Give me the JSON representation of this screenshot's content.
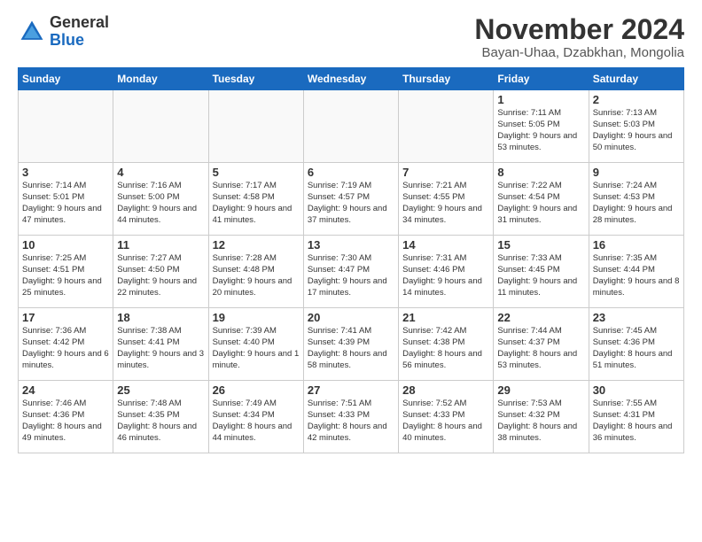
{
  "logo": {
    "general": "General",
    "blue": "Blue"
  },
  "header": {
    "month": "November 2024",
    "location": "Bayan-Uhaa, Dzabkhan, Mongolia"
  },
  "weekdays": [
    "Sunday",
    "Monday",
    "Tuesday",
    "Wednesday",
    "Thursday",
    "Friday",
    "Saturday"
  ],
  "weeks": [
    [
      {
        "day": "",
        "info": ""
      },
      {
        "day": "",
        "info": ""
      },
      {
        "day": "",
        "info": ""
      },
      {
        "day": "",
        "info": ""
      },
      {
        "day": "",
        "info": ""
      },
      {
        "day": "1",
        "info": "Sunrise: 7:11 AM\nSunset: 5:05 PM\nDaylight: 9 hours and 53 minutes."
      },
      {
        "day": "2",
        "info": "Sunrise: 7:13 AM\nSunset: 5:03 PM\nDaylight: 9 hours and 50 minutes."
      }
    ],
    [
      {
        "day": "3",
        "info": "Sunrise: 7:14 AM\nSunset: 5:01 PM\nDaylight: 9 hours and 47 minutes."
      },
      {
        "day": "4",
        "info": "Sunrise: 7:16 AM\nSunset: 5:00 PM\nDaylight: 9 hours and 44 minutes."
      },
      {
        "day": "5",
        "info": "Sunrise: 7:17 AM\nSunset: 4:58 PM\nDaylight: 9 hours and 41 minutes."
      },
      {
        "day": "6",
        "info": "Sunrise: 7:19 AM\nSunset: 4:57 PM\nDaylight: 9 hours and 37 minutes."
      },
      {
        "day": "7",
        "info": "Sunrise: 7:21 AM\nSunset: 4:55 PM\nDaylight: 9 hours and 34 minutes."
      },
      {
        "day": "8",
        "info": "Sunrise: 7:22 AM\nSunset: 4:54 PM\nDaylight: 9 hours and 31 minutes."
      },
      {
        "day": "9",
        "info": "Sunrise: 7:24 AM\nSunset: 4:53 PM\nDaylight: 9 hours and 28 minutes."
      }
    ],
    [
      {
        "day": "10",
        "info": "Sunrise: 7:25 AM\nSunset: 4:51 PM\nDaylight: 9 hours and 25 minutes."
      },
      {
        "day": "11",
        "info": "Sunrise: 7:27 AM\nSunset: 4:50 PM\nDaylight: 9 hours and 22 minutes."
      },
      {
        "day": "12",
        "info": "Sunrise: 7:28 AM\nSunset: 4:48 PM\nDaylight: 9 hours and 20 minutes."
      },
      {
        "day": "13",
        "info": "Sunrise: 7:30 AM\nSunset: 4:47 PM\nDaylight: 9 hours and 17 minutes."
      },
      {
        "day": "14",
        "info": "Sunrise: 7:31 AM\nSunset: 4:46 PM\nDaylight: 9 hours and 14 minutes."
      },
      {
        "day": "15",
        "info": "Sunrise: 7:33 AM\nSunset: 4:45 PM\nDaylight: 9 hours and 11 minutes."
      },
      {
        "day": "16",
        "info": "Sunrise: 7:35 AM\nSunset: 4:44 PM\nDaylight: 9 hours and 8 minutes."
      }
    ],
    [
      {
        "day": "17",
        "info": "Sunrise: 7:36 AM\nSunset: 4:42 PM\nDaylight: 9 hours and 6 minutes."
      },
      {
        "day": "18",
        "info": "Sunrise: 7:38 AM\nSunset: 4:41 PM\nDaylight: 9 hours and 3 minutes."
      },
      {
        "day": "19",
        "info": "Sunrise: 7:39 AM\nSunset: 4:40 PM\nDaylight: 9 hours and 1 minute."
      },
      {
        "day": "20",
        "info": "Sunrise: 7:41 AM\nSunset: 4:39 PM\nDaylight: 8 hours and 58 minutes."
      },
      {
        "day": "21",
        "info": "Sunrise: 7:42 AM\nSunset: 4:38 PM\nDaylight: 8 hours and 56 minutes."
      },
      {
        "day": "22",
        "info": "Sunrise: 7:44 AM\nSunset: 4:37 PM\nDaylight: 8 hours and 53 minutes."
      },
      {
        "day": "23",
        "info": "Sunrise: 7:45 AM\nSunset: 4:36 PM\nDaylight: 8 hours and 51 minutes."
      }
    ],
    [
      {
        "day": "24",
        "info": "Sunrise: 7:46 AM\nSunset: 4:36 PM\nDaylight: 8 hours and 49 minutes."
      },
      {
        "day": "25",
        "info": "Sunrise: 7:48 AM\nSunset: 4:35 PM\nDaylight: 8 hours and 46 minutes."
      },
      {
        "day": "26",
        "info": "Sunrise: 7:49 AM\nSunset: 4:34 PM\nDaylight: 8 hours and 44 minutes."
      },
      {
        "day": "27",
        "info": "Sunrise: 7:51 AM\nSunset: 4:33 PM\nDaylight: 8 hours and 42 minutes."
      },
      {
        "day": "28",
        "info": "Sunrise: 7:52 AM\nSunset: 4:33 PM\nDaylight: 8 hours and 40 minutes."
      },
      {
        "day": "29",
        "info": "Sunrise: 7:53 AM\nSunset: 4:32 PM\nDaylight: 8 hours and 38 minutes."
      },
      {
        "day": "30",
        "info": "Sunrise: 7:55 AM\nSunset: 4:31 PM\nDaylight: 8 hours and 36 minutes."
      }
    ]
  ]
}
